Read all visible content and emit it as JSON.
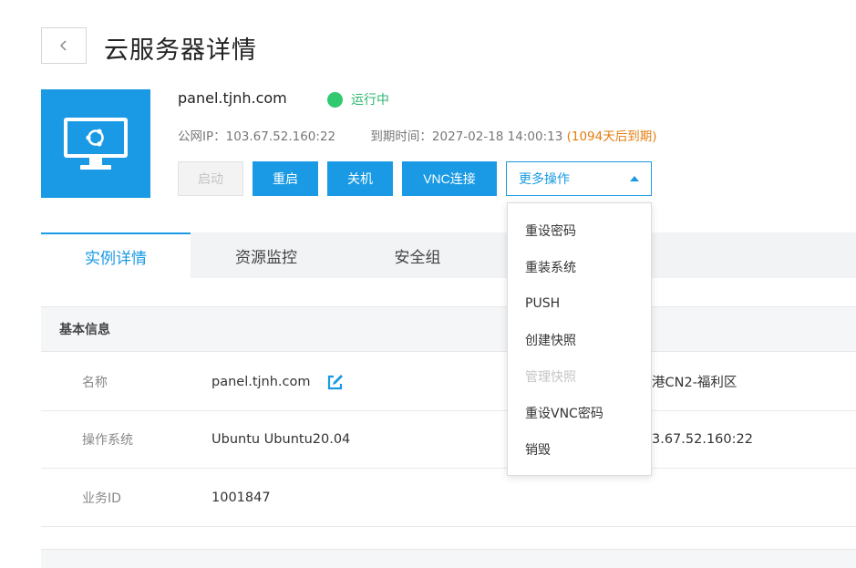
{
  "header": {
    "title": "云服务器详情"
  },
  "server": {
    "hostname": "panel.tjnh.com",
    "status": "运行中",
    "ip_label": "公网IP：",
    "ip": "103.67.52.160:22",
    "expire_label": "到期时间：",
    "expire_time": "2027-02-18 14:00:13",
    "expire_note": "(1094天后到期)"
  },
  "actions": {
    "start": "启动",
    "restart": "重启",
    "shutdown": "关机",
    "vnc": "VNC连接",
    "more": "更多操作"
  },
  "dropdown": {
    "items": [
      {
        "label": "重设密码",
        "enabled": true
      },
      {
        "label": "重装系统",
        "enabled": true
      },
      {
        "label": "PUSH",
        "enabled": true
      },
      {
        "label": "创建快照",
        "enabled": true
      },
      {
        "label": "管理快照",
        "enabled": false
      },
      {
        "label": "重设VNC密码",
        "enabled": true
      },
      {
        "label": "销毁",
        "enabled": true
      }
    ]
  },
  "tabs": [
    {
      "label": "实例详情",
      "active": true
    },
    {
      "label": "资源监控",
      "active": false
    },
    {
      "label": "安全组",
      "active": false
    }
  ],
  "basic_info": {
    "title": "基本信息",
    "rows": [
      {
        "label": "名称",
        "value": "panel.tjnh.com",
        "right_label": "",
        "right_value": "港CN2-福利区"
      },
      {
        "label": "操作系统",
        "value": "Ubuntu Ubuntu20.04",
        "right_label": "",
        "right_value": "3.67.52.160:22"
      },
      {
        "label": "业务ID",
        "value": "1001847"
      }
    ]
  },
  "next_section": {
    "title": ""
  },
  "colors": {
    "accent": "#1a9ae4",
    "running": "#31c96f",
    "warning": "#e47d10"
  },
  "icons": {
    "back": "chevron-left-icon",
    "monitor": "monitor-ubuntu-icon",
    "edit": "edit-icon"
  }
}
